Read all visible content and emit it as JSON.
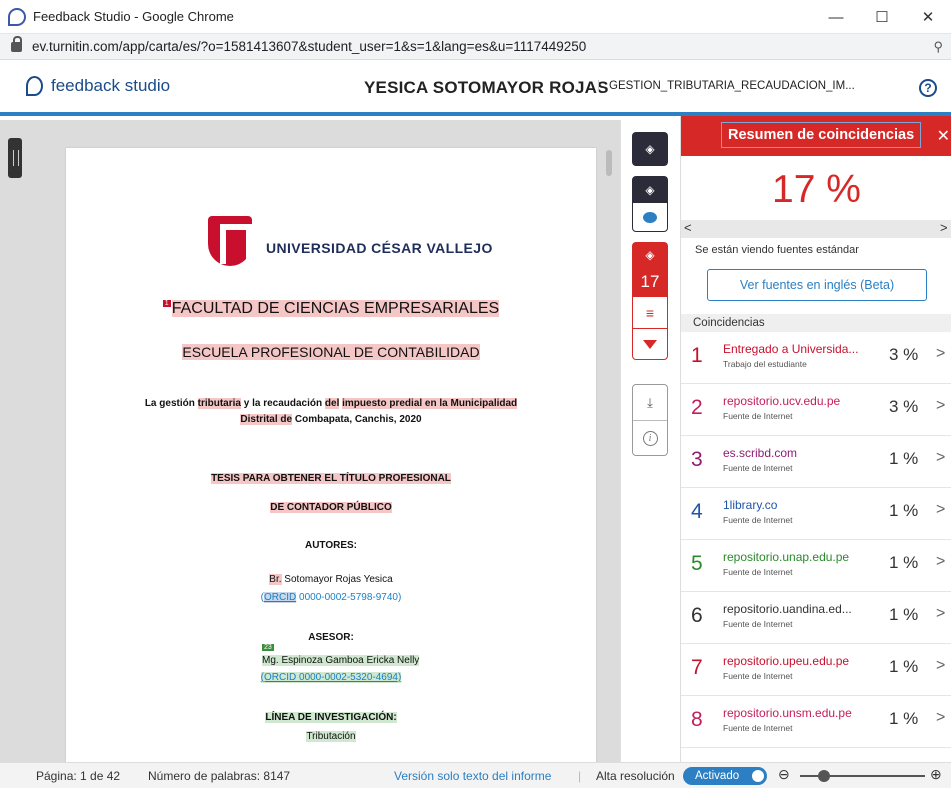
{
  "window": {
    "title": "Feedback Studio - Google Chrome",
    "minimize": "—",
    "maximize": "☐",
    "close": "✕"
  },
  "browser": {
    "url": "ev.turnitin.com/app/carta/es/?o=1581413607&student_user=1&s=1&lang=es&u=1117449250",
    "zoom_icon": "⚲"
  },
  "app": {
    "logo_text": "feedback studio",
    "student_name": "YESICA SOTOMAYOR ROJAS",
    "assignment": "GESTION_TRIBUTARIA_RECAUDACION_IM...",
    "help": "?"
  },
  "document": {
    "university": "UNIVERSIDAD CÉSAR VALLEJO",
    "mark1": "1",
    "faculty": "FACULTAD DE CIENCIAS EMPRESARIALES",
    "school": "ESCUELA PROFESIONAL DE CONTABILIDAD",
    "title_parts": [
      "La gestión ",
      "tributaria",
      " y la recaudación ",
      "del",
      " ",
      "impuesto predial en la Municipalidad"
    ],
    "title_line2_parts": [
      "Distrital de",
      " Combapata, Canchis, 2020"
    ],
    "thesis1": "TESIS PARA OBTENER EL TÍTULO PROFESIONAL",
    "thesis2": "DE CONTADOR PÚBLICO",
    "authors_label": "AUTORES:",
    "author_prefix": "Br.",
    "author_name": " Sotomayor Rojas Yesica",
    "author_orcid_open": "(",
    "author_orcid_label": "ORCID",
    "author_orcid_id": " 0000-0002-5798-9740)",
    "advisor_label": "ASESOR:",
    "mark23": "23",
    "advisor_name": "Mg. Espinoza Gamboa Ericka Nelly",
    "advisor_orcid": "(ORCID 0000-0002-5320-4694)",
    "line_label": "LÍNEA DE INVESTIGACIÓN:",
    "line_value": "Tributación"
  },
  "toolbar": {
    "layers": "◈",
    "similarity_count": "17",
    "download": "⤓",
    "info": "i"
  },
  "panel": {
    "title": "Resumen de coincidencias",
    "close": "✕",
    "overall_percent": "17 %",
    "nav_prev": "<",
    "nav_next": ">",
    "source_note": "Se están viendo fuentes estándar",
    "english_button": "Ver fuentes en inglés (Beta)",
    "matches_header": "Coincidencias",
    "matches": [
      {
        "num": "1",
        "name": "Entregado a Universida...",
        "type": "Trabajo del estudiante",
        "pct": "3 %",
        "color": "#c8102e"
      },
      {
        "num": "2",
        "name": "repositorio.ucv.edu.pe",
        "type": "Fuente de Internet",
        "pct": "3 %",
        "color": "#c41e5a"
      },
      {
        "num": "3",
        "name": "es.scribd.com",
        "type": "Fuente de Internet",
        "pct": "1 %",
        "color": "#8e1c74"
      },
      {
        "num": "4",
        "name": "1library.co",
        "type": "Fuente de Internet",
        "pct": "1 %",
        "color": "#2056a8"
      },
      {
        "num": "5",
        "name": "repositorio.unap.edu.pe",
        "type": "Fuente de Internet",
        "pct": "1 %",
        "color": "#2b8a2b"
      },
      {
        "num": "6",
        "name": "repositorio.uandina.ed...",
        "type": "Fuente de Internet",
        "pct": "1 %",
        "color": "#333333"
      },
      {
        "num": "7",
        "name": "repositorio.upeu.edu.pe",
        "type": "Fuente de Internet",
        "pct": "1 %",
        "color": "#c8102e"
      },
      {
        "num": "8",
        "name": "repositorio.unsm.edu.pe",
        "type": "Fuente de Internet",
        "pct": "1 %",
        "color": "#c41e5a"
      }
    ],
    "chevron": ">"
  },
  "status": {
    "page": "Página: 1 de 42",
    "words": "Número de palabras: 8147",
    "text_only": "Versión solo texto del informe",
    "separator": "|",
    "high_res": "Alta resolución",
    "toggle_label": "Activado",
    "zoom_out": "⊖",
    "zoom_in": "⊕"
  },
  "colors": {
    "accent_blue": "#2b7fc2",
    "accent_red": "#d72828"
  }
}
